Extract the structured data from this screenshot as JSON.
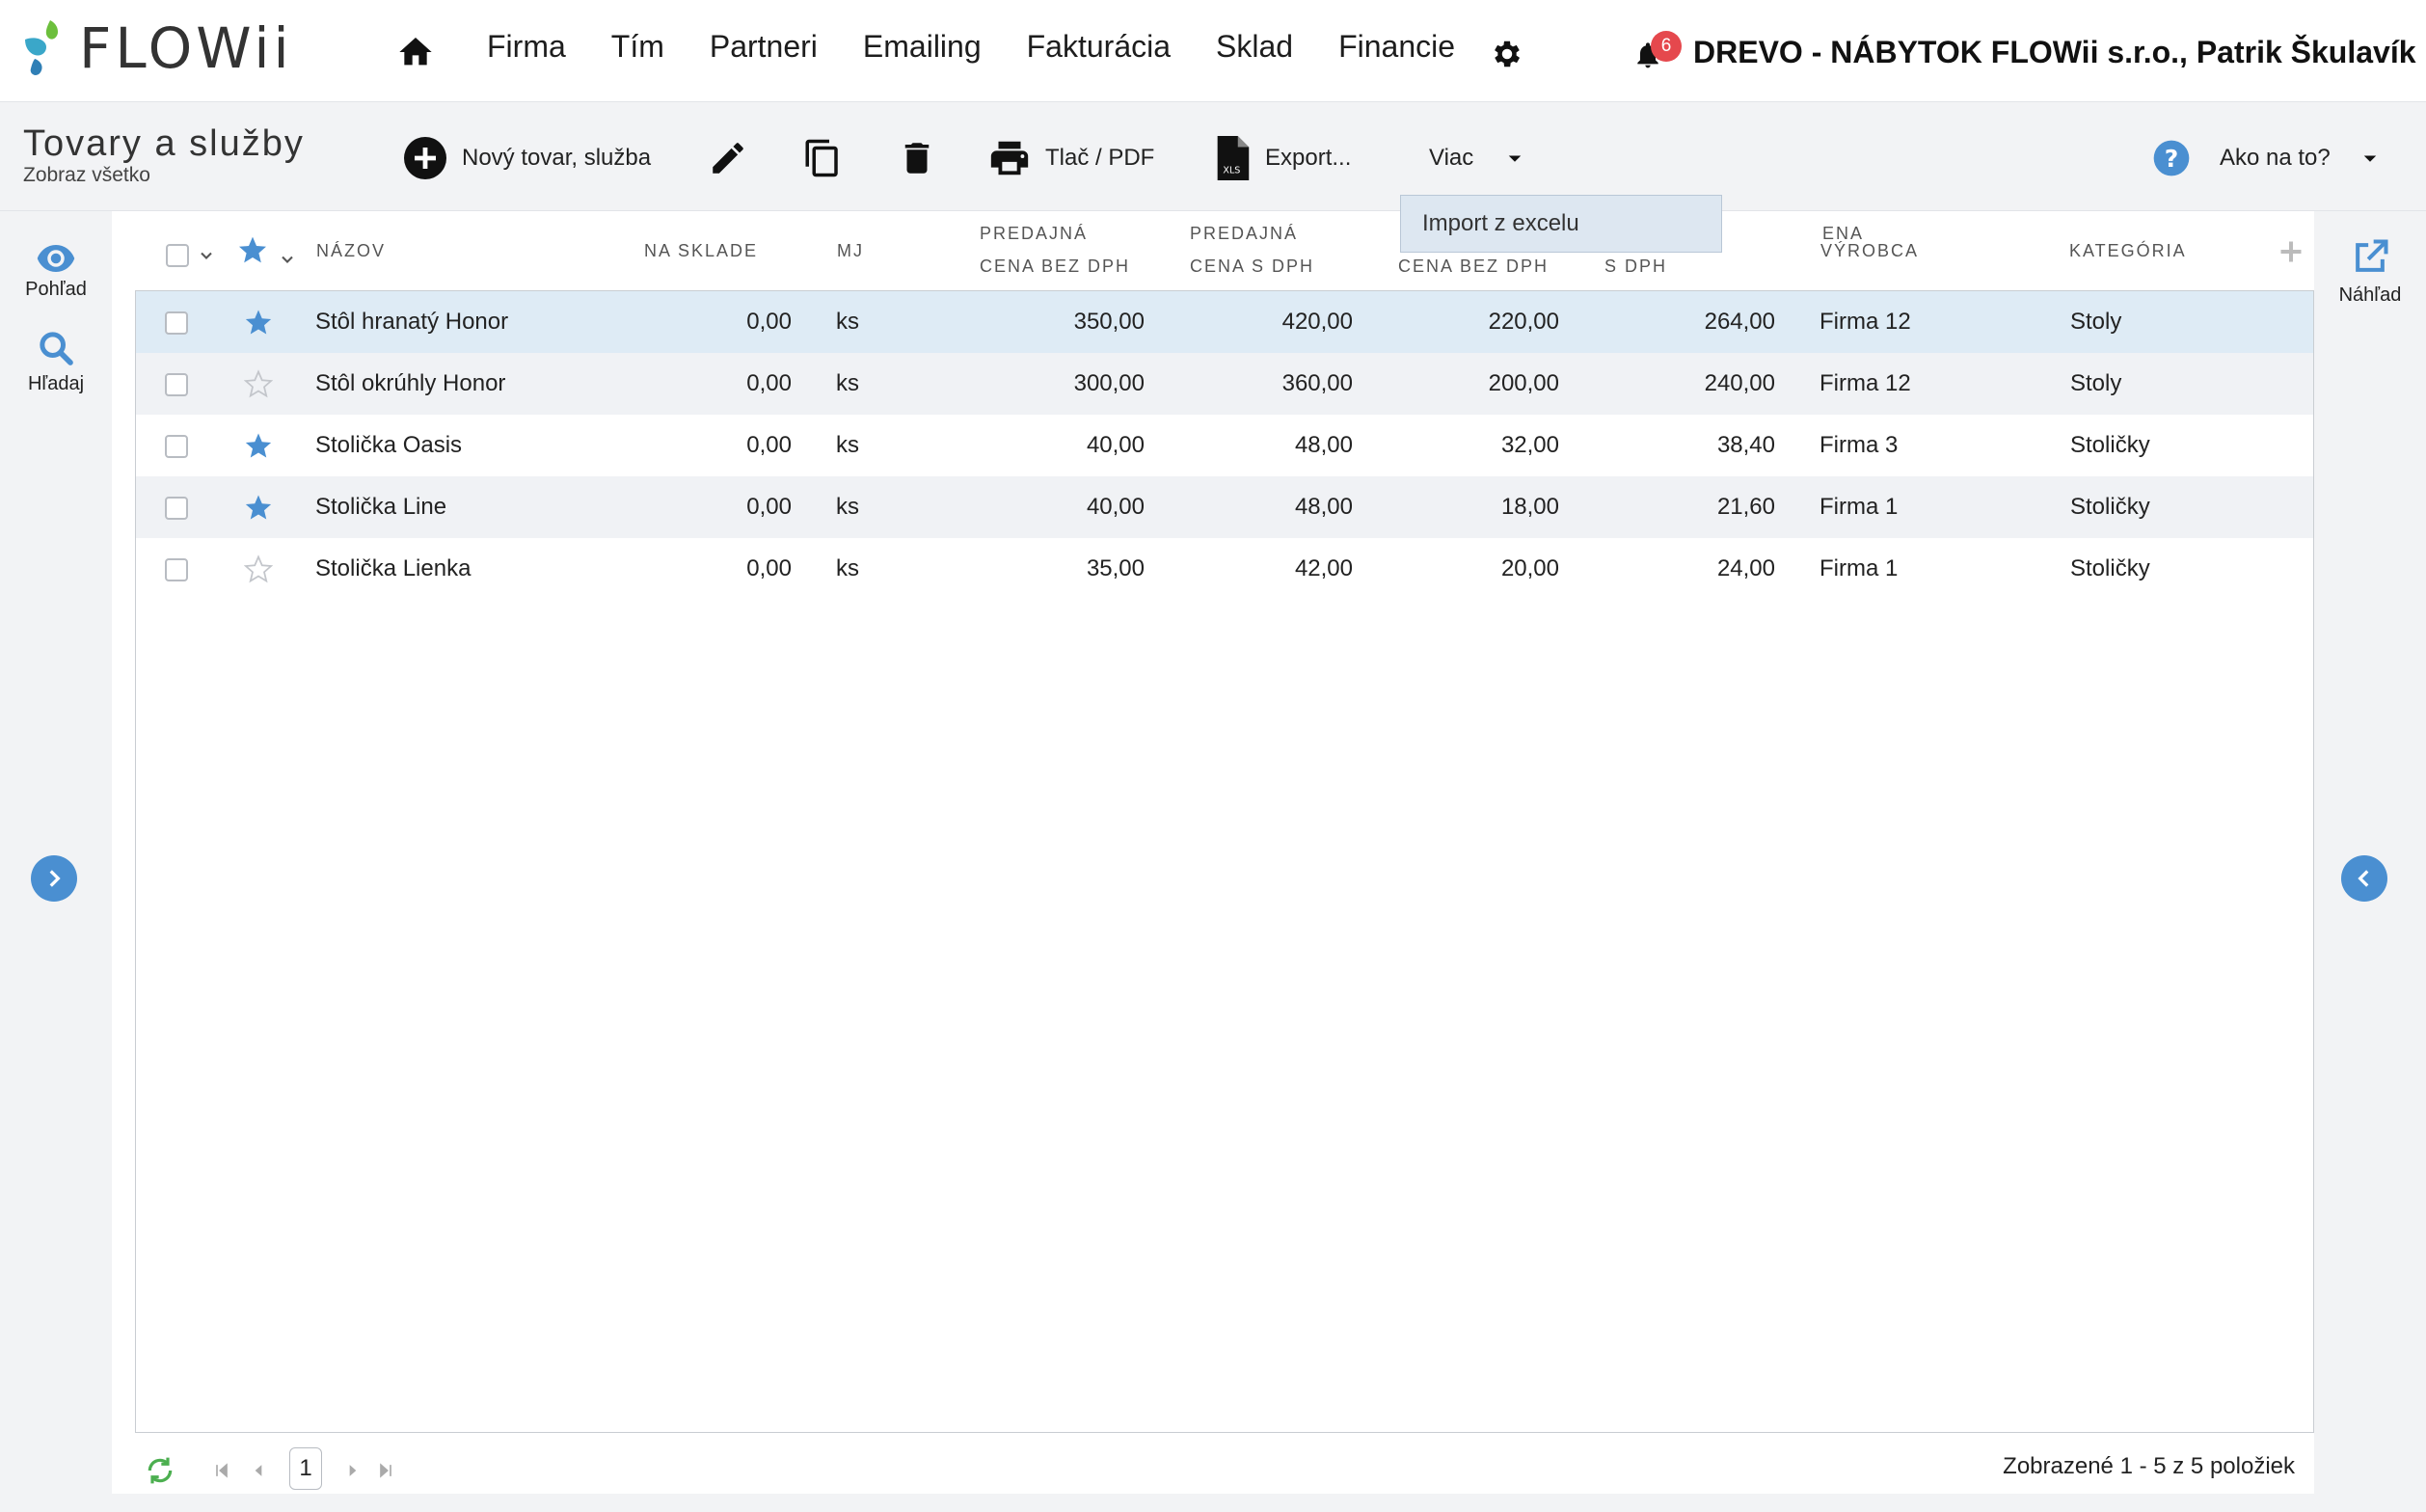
{
  "brand": {
    "logo_text": "FLOWii"
  },
  "nav": {
    "items": [
      "Firma",
      "Tím",
      "Partneri",
      "Emailing",
      "Fakturácia",
      "Sklad",
      "Financie"
    ],
    "notifications_count": "6",
    "company_user": "DREVO - NÁBYTOK FLOWii s.r.o., Patrik Škulavík"
  },
  "page": {
    "title": "Tovary a služby",
    "subtitle": "Zobraz všetko"
  },
  "toolbar": {
    "new_label": "Nový tovar, služba",
    "print_label": "Tlač / PDF",
    "export_label": "Export...",
    "more_label": "Viac",
    "help_label": "Ako na to?"
  },
  "dropdown": {
    "items": [
      "Import z excelu"
    ]
  },
  "leftrail": {
    "view_label": "Pohľad",
    "search_label": "Hľadaj"
  },
  "rightrail": {
    "preview_label": "Náhľad"
  },
  "table": {
    "headers": {
      "name": "NÁZOV",
      "stock": "NA SKLADE",
      "unit": "MJ",
      "sell_net_1": "PREDAJNÁ",
      "sell_net_2": "CENA BEZ DPH",
      "sell_gross_1": "PREDAJNÁ",
      "sell_gross_2": "CENA S DPH",
      "buy_net_1": "",
      "buy_net_2": "CENA BEZ DPH",
      "buy_gross_1": "ENA",
      "buy_gross_2": "S DPH",
      "maker": "VÝROBCA",
      "category": "KATEGÓRIA"
    },
    "rows": [
      {
        "starred": true,
        "name": "Stôl hranatý Honor",
        "stock": "0,00",
        "unit": "ks",
        "sell_net": "350,00",
        "sell_gross": "420,00",
        "buy_net": "220,00",
        "buy_gross": "264,00",
        "maker": "Firma 12",
        "category": "Stoly"
      },
      {
        "starred": false,
        "name": "Stôl okrúhly Honor",
        "stock": "0,00",
        "unit": "ks",
        "sell_net": "300,00",
        "sell_gross": "360,00",
        "buy_net": "200,00",
        "buy_gross": "240,00",
        "maker": "Firma 12",
        "category": "Stoly"
      },
      {
        "starred": true,
        "name": "Stolička Oasis",
        "stock": "0,00",
        "unit": "ks",
        "sell_net": "40,00",
        "sell_gross": "48,00",
        "buy_net": "32,00",
        "buy_gross": "38,40",
        "maker": "Firma 3",
        "category": "Stoličky"
      },
      {
        "starred": true,
        "name": "Stolička Line",
        "stock": "0,00",
        "unit": "ks",
        "sell_net": "40,00",
        "sell_gross": "48,00",
        "buy_net": "18,00",
        "buy_gross": "21,60",
        "maker": "Firma 1",
        "category": "Stoličky"
      },
      {
        "starred": false,
        "name": "Stolička Lienka",
        "stock": "0,00",
        "unit": "ks",
        "sell_net": "35,00",
        "sell_gross": "42,00",
        "buy_net": "20,00",
        "buy_gross": "24,00",
        "maker": "Firma 1",
        "category": "Stoličky"
      }
    ]
  },
  "pager": {
    "current_page": "1",
    "summary": "Zobrazené 1 - 5 z 5 položiek"
  },
  "colors": {
    "accent": "#4a8fd1",
    "selected_row": "#deebf5",
    "badge": "#e5484d"
  }
}
